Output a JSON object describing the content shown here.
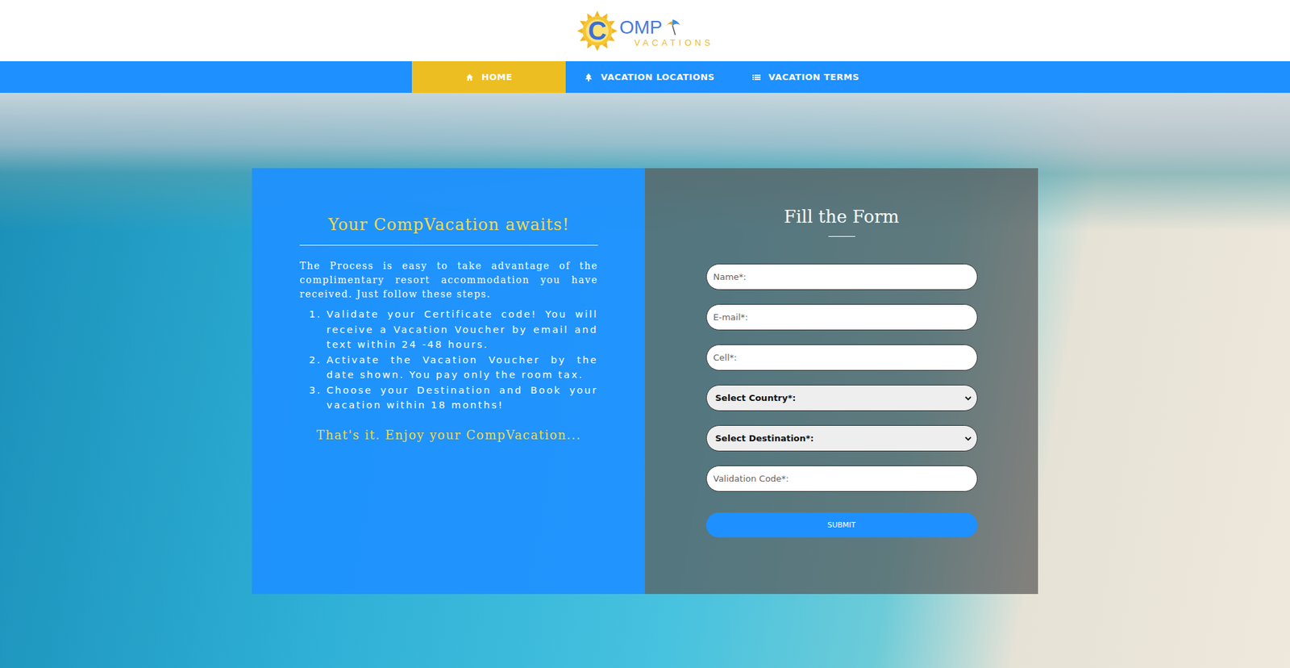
{
  "logo": {
    "letter": "C",
    "word": "OMP",
    "sub": "VACATIONS"
  },
  "nav": [
    {
      "label": "HOME",
      "selected": true
    },
    {
      "label": "VACATION LOCATIONS",
      "selected": false
    },
    {
      "label": "VACATION TERMS",
      "selected": false
    }
  ],
  "intro": {
    "title": "Your CompVacation awaits!",
    "text": "The Process is easy to take advantage of the complimentary resort accommodation you have received. Just follow these steps.",
    "steps": [
      "Validate your Certificate code! You will receive a Vacation Voucher by email and text within 24 -48 hours.",
      "Activate the Vacation Voucher by the date shown. You pay only the room tax.",
      "Choose your Destination and Book your vacation within 18 months!"
    ],
    "closing": "That's it. Enjoy your CompVacation..."
  },
  "form": {
    "title": "Fill the Form",
    "fields": [
      {
        "kind": "input",
        "text": "Name*:"
      },
      {
        "kind": "input",
        "text": "E-mail*:"
      },
      {
        "kind": "input",
        "text": "Cell*:"
      },
      {
        "kind": "select",
        "text": "Select Country*:"
      },
      {
        "kind": "select",
        "text": "Select Destination*:"
      },
      {
        "kind": "input",
        "text": "Validation Code*:"
      }
    ],
    "submit": "SUBMIT"
  }
}
